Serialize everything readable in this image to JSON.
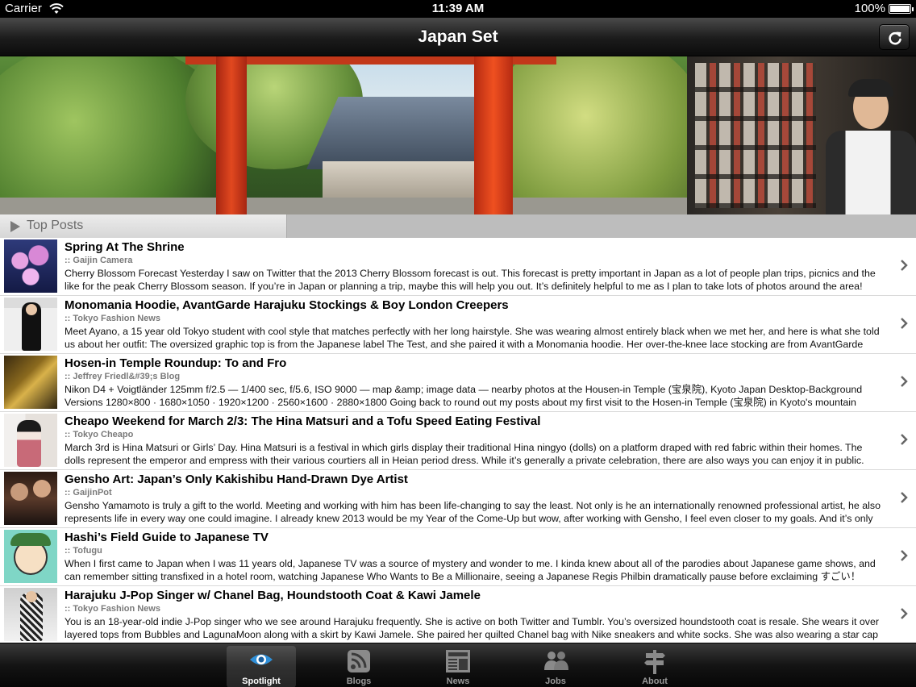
{
  "status_bar": {
    "carrier": "Carrier",
    "time": "11:39 AM",
    "battery": "100%"
  },
  "navbar": {
    "title": "Japan Set"
  },
  "section": {
    "label": "Top Posts"
  },
  "posts": [
    {
      "title": "Spring At The Shrine",
      "source": ":: Gaijin Camera",
      "excerpt": "Cherry Blossom Forecast Yesterday I saw on Twitter that the 2013 Cherry Blossom forecast is out. This forecast is pretty important in Japan as a lot of people plan trips, picnics and the like for the peak Cherry Blossom season. If you’re in Japan or planning a trip, maybe this will help you out. It’s definitely helpful to me as I plan to take lots of photos around the area! You"
    },
    {
      "title": "Monomania Hoodie, AvantGarde Harajuku Stockings & Boy London Creepers",
      "source": ":: Tokyo Fashion News",
      "excerpt": "Meet Ayano, a 15 year old Tokyo student with cool style that matches perfectly with her long hairstyle. She was wearing almost entirely black when we met her, and here is what she told us about her outfit: The oversized graphic top is from the Japanese label The Test, and she paired it with a Monomania hoodie. Her over-the-knee lace stocking are from AvantGarde"
    },
    {
      "title": "Hosen-in Temple Roundup: To and Fro",
      "source": ":: Jeffrey Friedl&#39;s Blog",
      "excerpt": " Nikon D4 + Voigtländer 125mm f/2.5 — 1/400 sec, f/5.6, ISO 9000 — map &amp; image data — nearby photos at the Housen-in Temple (宝泉院), Kyoto Japan Desktop-Background Versions 1280×800  ·  1680×1050  ·  1920×1200  ·  2560×1600  ·  2880×1800  Going back to round out my posts about my first visit to the Hosen-in Temple (宝泉院) in Kyoto's mountain"
    },
    {
      "title": "Cheapo Weekend for March 2/3: The Hina Matsuri and a Tofu Speed Eating Festival",
      "source": ":: Tokyo Cheapo",
      "excerpt": " March 3rd is Hina Matsuri or Girls’ Day. Hina Matsuri is a festival in which girls display their traditional Hina ningyo (dolls) on a platform draped with red fabric within their homes. The dolls represent the emperor and empress with their various courtiers all in Heian period dress.  While it’s generally a private celebration, there are also ways you can enjoy it in public.  One such"
    },
    {
      "title": "Gensho Art: Japan’s Only Kakishibu Hand-Drawn Dye Artist",
      "source": ":: GaijinPot",
      "excerpt": " Gensho Yamamoto is truly a gift to the world. Meeting and working with him has been life-changing to say the least. Not only is he an internationally renowned professional artist, he also represents life in every way one could imagine. I already knew 2013 would be my Year of the Come-Up but wow, after working with Gensho, I feel even closer to my goals. And it’s only"
    },
    {
      "title": "Hashi’s Field Guide to Japanese TV",
      "source": ":: Tofugu",
      "excerpt": "      When I first came to Japan when I was 11 years old, Japanese TV was a source of mystery and wonder to me. I kinda knew about all of the parodies about Japanese game shows, and can remember sitting transfixed in a hotel room, watching Japanese Who Wants to Be a Millionaire, seeing a Japanese Regis Philbin dramatically pause before exclaiming すごい！ Now"
    },
    {
      "title": "Harajuku J-Pop Singer w/ Chanel Bag, Houndstooth Coat & Kawi Jamele",
      "source": ":: Tokyo Fashion News",
      "excerpt": "You is an 18-year-old indie J-Pop singer who we see around Harajuku frequently. She is active on both Twitter and Tumblr. You’s oversized houndstooth coat is resale. She wears it over layered tops from Bubbles and LagunaMoon along with a skirt by Kawi Jamele. She paired her quilted Chanel bag with Nike sneakers and white socks. She was also wearing a star cap ("
    }
  ],
  "tabs": [
    {
      "label": "Spotlight",
      "icon": "eye-icon",
      "active": true
    },
    {
      "label": "Blogs",
      "icon": "rss-icon",
      "active": false
    },
    {
      "label": "News",
      "icon": "newspaper-icon",
      "active": false
    },
    {
      "label": "Jobs",
      "icon": "people-icon",
      "active": false
    },
    {
      "label": "About",
      "icon": "signpost-icon",
      "active": false
    }
  ],
  "colors": {
    "accent_blue": "#2f8fd8",
    "bar_dark": "#141414"
  }
}
